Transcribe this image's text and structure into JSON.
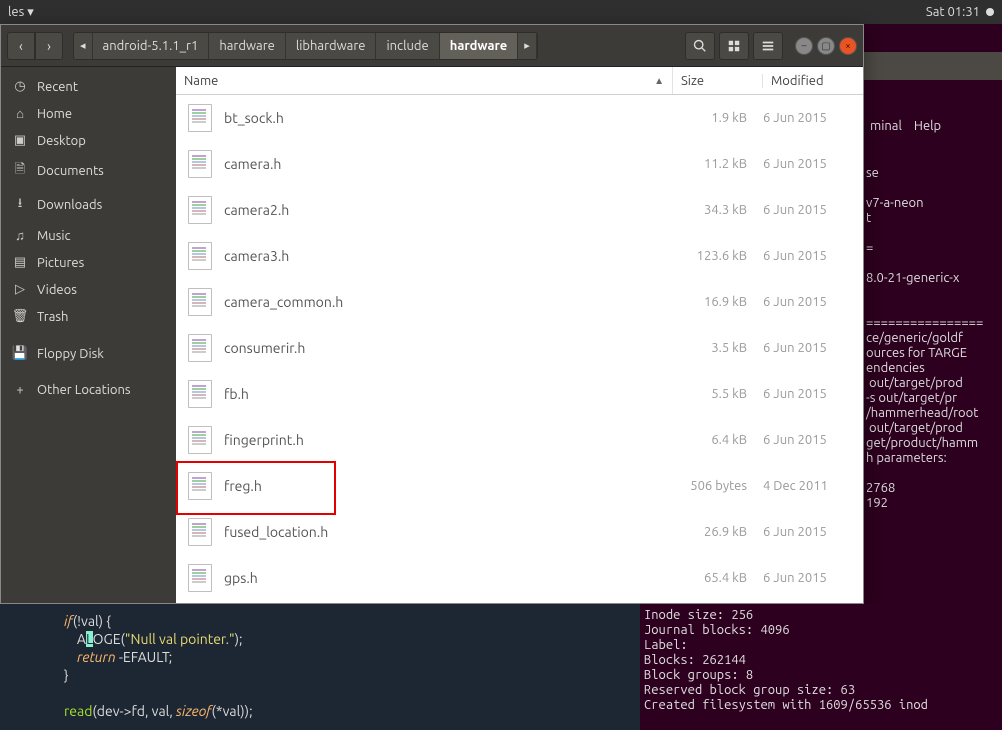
{
  "menubar": {
    "left": "les ▾",
    "time": "Sat 01:31"
  },
  "fm": {
    "path": [
      "◂",
      "android-5.1.1_r1",
      "hardware",
      "libhardware",
      "include",
      "hardware",
      "▸"
    ],
    "active_path_index": 5,
    "columns": {
      "name": "Name",
      "size": "Size",
      "modified": "Modified"
    },
    "sidebar": [
      {
        "icon": "clock-icon",
        "glyph": "◷",
        "label": "Recent"
      },
      {
        "icon": "home-icon",
        "glyph": "⌂",
        "label": "Home"
      },
      {
        "icon": "desktop-icon",
        "glyph": "▣",
        "label": "Desktop"
      },
      {
        "icon": "documents-icon",
        "glyph": "🗎",
        "label": "Documents"
      },
      {
        "icon": "downloads-icon",
        "glyph": "⭳",
        "label": "Downloads"
      },
      {
        "icon": "music-icon",
        "glyph": "♫",
        "label": "Music"
      },
      {
        "icon": "pictures-icon",
        "glyph": "▤",
        "label": "Pictures"
      },
      {
        "icon": "videos-icon",
        "glyph": "▷",
        "label": "Videos"
      },
      {
        "icon": "trash-icon",
        "glyph": "🗑",
        "label": "Trash"
      },
      {
        "icon": "floppy-icon",
        "glyph": "💾",
        "label": "Floppy Disk"
      },
      {
        "icon": "other-icon",
        "glyph": "+",
        "label": "Other Locations"
      }
    ],
    "files": [
      {
        "name": "bt_sock.h",
        "size": "1.9 kB",
        "modified": "6 Jun 2015"
      },
      {
        "name": "camera.h",
        "size": "11.2 kB",
        "modified": "6 Jun 2015"
      },
      {
        "name": "camera2.h",
        "size": "34.3 kB",
        "modified": "6 Jun 2015"
      },
      {
        "name": "camera3.h",
        "size": "123.6 kB",
        "modified": "6 Jun 2015"
      },
      {
        "name": "camera_common.h",
        "size": "16.9 kB",
        "modified": "6 Jun 2015"
      },
      {
        "name": "consumerir.h",
        "size": "3.5 kB",
        "modified": "6 Jun 2015"
      },
      {
        "name": "fb.h",
        "size": "5.5 kB",
        "modified": "6 Jun 2015"
      },
      {
        "name": "fingerprint.h",
        "size": "6.4 kB",
        "modified": "6 Jun 2015"
      },
      {
        "name": "freg.h",
        "size": "506 bytes",
        "modified": "4 Dec 2011",
        "highlight": true
      },
      {
        "name": "fused_location.h",
        "size": "26.9 kB",
        "modified": "6 Jun 2015"
      },
      {
        "name": "gps.h",
        "size": "65.4 kB",
        "modified": "6 Jun 2015"
      }
    ]
  },
  "terminal_right": {
    "menu": [
      "minal",
      "Help"
    ],
    "lines": [
      "se",
      "",
      "v7-a-neon",
      "t",
      "",
      "=",
      "",
      "8.0-21-generic-x",
      "",
      "",
      "================",
      "ce/generic/goldf",
      "ources for TARGE",
      "endencies",
      " out/target/prod",
      "-s out/target/pr",
      "/hammerhead/root",
      " out/target/prod",
      "get/product/hamm",
      "h parameters:",
      "",
      "2768",
      "192"
    ]
  },
  "code": {
    "l1a": "if",
    "l1b": "(!val) {",
    "l2a": "    A",
    "l2b": "L",
    "l2c": "OGE",
    "l2d": "(",
    "l2e": "\"Null val pointer.\"",
    "l2f": ");",
    "l3a": "    return",
    "l3b": " -EFAULT;",
    "l4": "}",
    "l5a": "read",
    "l5b": "(dev->fd, val, ",
    "l5c": "sizeof",
    "l5d": "(*val));"
  },
  "btm": {
    "lines": [
      "Inode size: 256",
      "Journal blocks: 4096",
      "Label:",
      "Blocks: 262144",
      "Block groups: 8",
      "Reserved block group size: 63",
      "Created filesystem with 1609/65536 inod"
    ]
  }
}
